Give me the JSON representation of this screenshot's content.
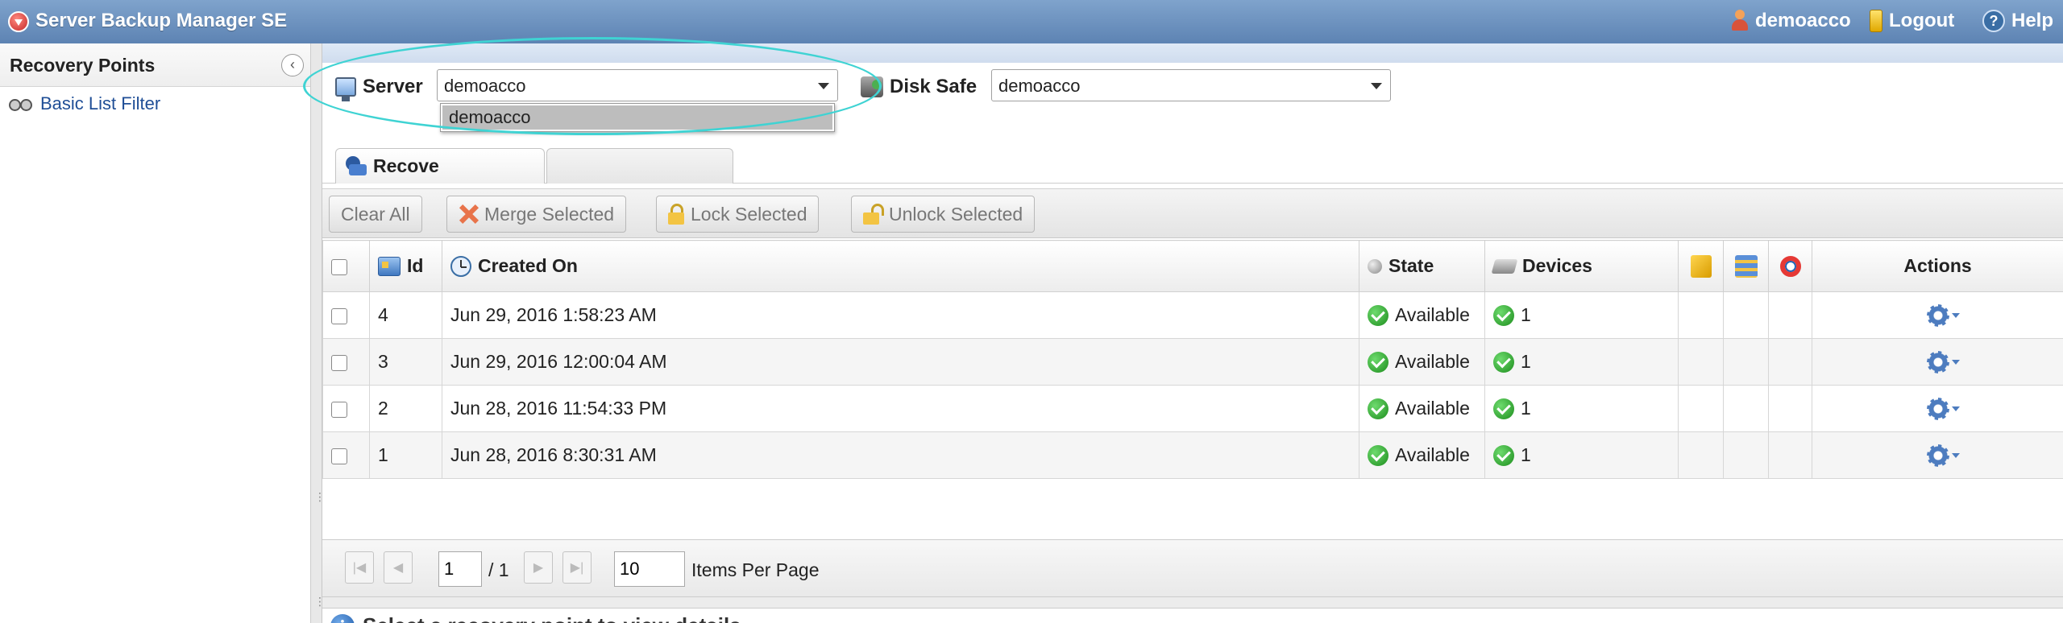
{
  "app": {
    "title": "Server Backup Manager SE"
  },
  "topbar": {
    "user": "demoacco",
    "logout": "Logout",
    "help": "Help"
  },
  "left_panel": {
    "title": "Recovery Points",
    "filter_link": "Basic List Filter"
  },
  "selectors": {
    "server_label": "Server",
    "server_value": "demoacco",
    "disk_safe_label": "Disk Safe",
    "disk_safe_value": "demoacco",
    "dropdown_option": "demoacco"
  },
  "tabs": {
    "active_partial": "Recove"
  },
  "toolbar": {
    "clear_all": "Clear All",
    "merge_selected": "Merge Selected",
    "lock_selected": "Lock Selected",
    "unlock_selected": "Unlock Selected"
  },
  "table": {
    "headers": {
      "id": "Id",
      "created_on": "Created On",
      "state": "State",
      "devices": "Devices",
      "actions": "Actions"
    },
    "rows": [
      {
        "id": "4",
        "created_on": "Jun 29, 2016 1:58:23 AM",
        "state": "Available",
        "devices": "1"
      },
      {
        "id": "3",
        "created_on": "Jun 29, 2016 12:00:04 AM",
        "state": "Available",
        "devices": "1"
      },
      {
        "id": "2",
        "created_on": "Jun 28, 2016 11:54:33 PM",
        "state": "Available",
        "devices": "1"
      },
      {
        "id": "1",
        "created_on": "Jun 28, 2016 8:30:31 AM",
        "state": "Available",
        "devices": "1"
      }
    ]
  },
  "pager": {
    "page": "1",
    "total": "/ 1",
    "per_page": "10",
    "per_page_label": "Items Per Page"
  },
  "detail": {
    "message": "Select a recovery point to view details"
  }
}
